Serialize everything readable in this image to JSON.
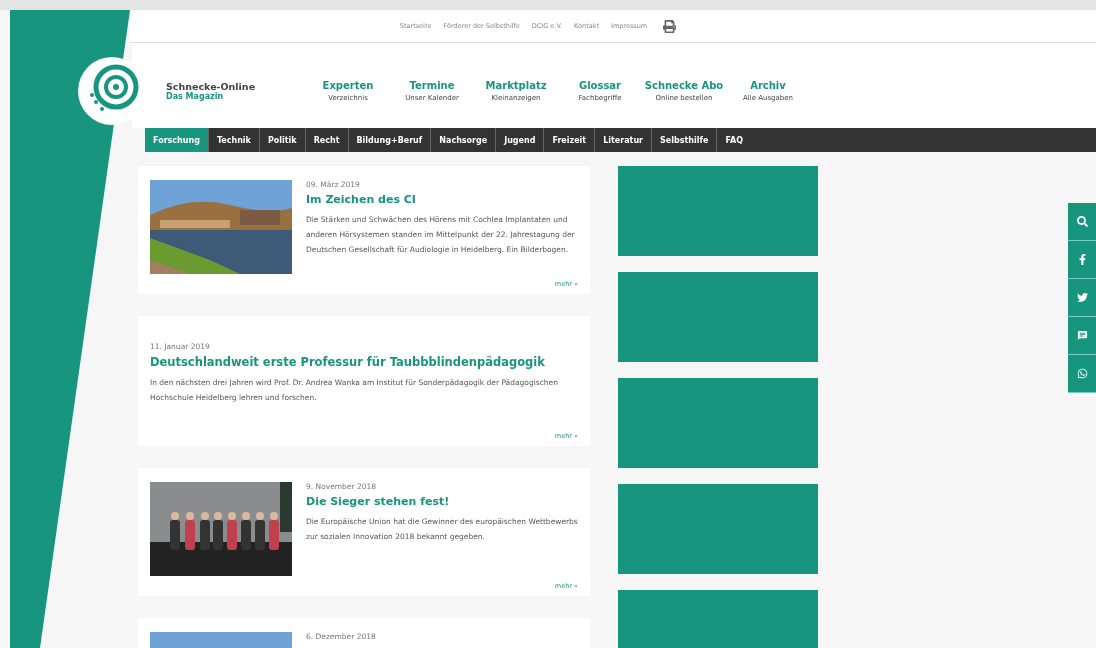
{
  "top_links": [
    "Startseite",
    "Förderer der Selbsthilfe",
    "DCIG e.V.",
    "Kontakt",
    "Impressum"
  ],
  "brand": {
    "name": "Schnecke-Online",
    "tagline": "Das Magazin"
  },
  "main_nav": [
    {
      "title": "Experten",
      "subtitle": "Verzeichnis"
    },
    {
      "title": "Termine",
      "subtitle": "Unser Kalender"
    },
    {
      "title": "Marktplatz",
      "subtitle": "Kleinanzeigen"
    },
    {
      "title": "Glossar",
      "subtitle": "Fachbegriffe"
    },
    {
      "title": "Schnecke Abo",
      "subtitle": "Online bestellen"
    },
    {
      "title": "Archiv",
      "subtitle": "Alle Ausgaben"
    }
  ],
  "categories": [
    {
      "label": "Forschung",
      "selected": true
    },
    {
      "label": "Technik",
      "selected": false
    },
    {
      "label": "Politik",
      "selected": false
    },
    {
      "label": "Recht",
      "selected": false
    },
    {
      "label": "Bildung+Beruf",
      "selected": false
    },
    {
      "label": "Nachsorge",
      "selected": false
    },
    {
      "label": "Jugend",
      "selected": false
    },
    {
      "label": "Freizeit",
      "selected": false
    },
    {
      "label": "Literatur",
      "selected": false
    },
    {
      "label": "Selbsthilfe",
      "selected": false
    },
    {
      "label": "FAQ",
      "selected": false
    }
  ],
  "articles": [
    {
      "date": "09. März 2019",
      "title": "Im Zeichen des CI",
      "text": "Die Stärken und Schwächen des Hörens mit Cochlea Implantaten und anderen Hörsystemen standen im Mittelpunkt der 22. Jahrestagung der Deutschen Gesellschaft für Audiologie in Heidelberg. Ein Bilderbogen.",
      "more": "mehr »"
    },
    {
      "kind": "text",
      "date": "11. Januar 2019",
      "title": "Deutschlandweit erste Professur für Taubbblindenpädagogik",
      "text": "In den nächsten drei Jahren wird Prof. Dr. Andrea Wanka am Institut für Sonderpädagogik der Pädagogischen Hochschule Heidelberg lehren und forschen.",
      "more": "mehr »"
    },
    {
      "date": "9. November 2018",
      "title": "Die Sieger stehen fest!",
      "text": "Die Europäische Union hat die Gewinner des europäischen Wettbewerbs zur sozialen Innovation 2018 bekannt gegeben.",
      "more": "mehr »"
    },
    {
      "date": "6. Dezember 2018"
    }
  ]
}
